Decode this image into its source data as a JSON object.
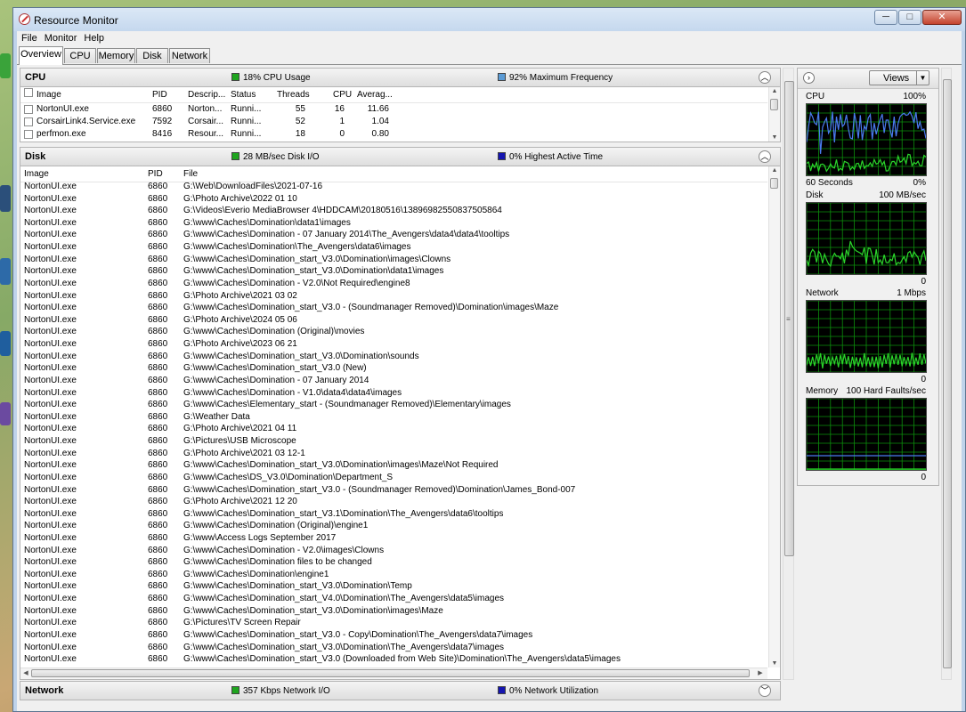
{
  "window": {
    "title": "Resource Monitor",
    "min": "─",
    "max": "□",
    "close": "✕"
  },
  "menu": [
    "File",
    "Monitor",
    "Help"
  ],
  "tabs": [
    "Overview",
    "CPU",
    "Memory",
    "Disk",
    "Network"
  ],
  "cpu": {
    "title": "CPU",
    "usage": "18% CPU Usage",
    "freq": "92% Maximum Frequency",
    "usage_color": "#1fa51f",
    "freq_color": "#5b9bd5",
    "columns": [
      "Image",
      "PID",
      "Descrip...",
      "Status",
      "Threads",
      "CPU",
      "Averag..."
    ],
    "rows": [
      {
        "image": "NortonUI.exe",
        "pid": "6860",
        "desc": "Norton...",
        "status": "Runni...",
        "threads": "55",
        "cpu": "16",
        "avg": "11.66"
      },
      {
        "image": "CorsairLink4.Service.exe",
        "pid": "7592",
        "desc": "Corsair...",
        "status": "Runni...",
        "threads": "52",
        "cpu": "1",
        "avg": "1.04"
      },
      {
        "image": "perfmon.exe",
        "pid": "8416",
        "desc": "Resour...",
        "status": "Runni...",
        "threads": "18",
        "cpu": "0",
        "avg": "0.80"
      }
    ]
  },
  "disk": {
    "title": "Disk",
    "io": "28 MB/sec Disk I/O",
    "active": "0% Highest Active Time",
    "io_color": "#1fa51f",
    "active_color": "#1515b0",
    "columns": [
      "Image",
      "PID",
      "File"
    ],
    "rows": [
      {
        "image": "NortonUI.exe",
        "pid": "6860",
        "file": "G:\\Web\\DownloadFiles\\2021-07-16"
      },
      {
        "image": "NortonUI.exe",
        "pid": "6860",
        "file": "G:\\Photo Archive\\2022 01 10"
      },
      {
        "image": "NortonUI.exe",
        "pid": "6860",
        "file": "G:\\Videos\\Everio MediaBrowser 4\\HDDCAM\\20180516\\13896982550837505864"
      },
      {
        "image": "NortonUI.exe",
        "pid": "6860",
        "file": "G:\\www\\Caches\\Domination\\data1\\images"
      },
      {
        "image": "NortonUI.exe",
        "pid": "6860",
        "file": "G:\\www\\Caches\\Domination - 07 January 2014\\The_Avengers\\data4\\data4\\tooltips"
      },
      {
        "image": "NortonUI.exe",
        "pid": "6860",
        "file": "G:\\www\\Caches\\Domination\\The_Avengers\\data6\\images"
      },
      {
        "image": "NortonUI.exe",
        "pid": "6860",
        "file": "G:\\www\\Caches\\Domination_start_V3.0\\Domination\\images\\Clowns"
      },
      {
        "image": "NortonUI.exe",
        "pid": "6860",
        "file": "G:\\www\\Caches\\Domination_start_V3.0\\Domination\\data1\\images"
      },
      {
        "image": "NortonUI.exe",
        "pid": "6860",
        "file": "G:\\www\\Caches\\Domination - V2.0\\Not Required\\engine8"
      },
      {
        "image": "NortonUI.exe",
        "pid": "6860",
        "file": "G:\\Photo Archive\\2021 03 02"
      },
      {
        "image": "NortonUI.exe",
        "pid": "6860",
        "file": "G:\\www\\Caches\\Domination_start_V3.0 - (Soundmanager Removed)\\Domination\\images\\Maze"
      },
      {
        "image": "NortonUI.exe",
        "pid": "6860",
        "file": "G:\\Photo Archive\\2024 05 06"
      },
      {
        "image": "NortonUI.exe",
        "pid": "6860",
        "file": "G:\\www\\Caches\\Domination (Original)\\movies"
      },
      {
        "image": "NortonUI.exe",
        "pid": "6860",
        "file": "G:\\Photo Archive\\2023 06 21"
      },
      {
        "image": "NortonUI.exe",
        "pid": "6860",
        "file": "G:\\www\\Caches\\Domination_start_V3.0\\Domination\\sounds"
      },
      {
        "image": "NortonUI.exe",
        "pid": "6860",
        "file": "G:\\www\\Caches\\Domination_start_V3.0 (New)"
      },
      {
        "image": "NortonUI.exe",
        "pid": "6860",
        "file": "G:\\www\\Caches\\Domination - 07 January 2014"
      },
      {
        "image": "NortonUI.exe",
        "pid": "6860",
        "file": "G:\\www\\Caches\\Domination - V1.0\\data4\\data4\\images"
      },
      {
        "image": "NortonUI.exe",
        "pid": "6860",
        "file": "G:\\www\\Caches\\Elementary_start - (Soundmanager Removed)\\Elementary\\images"
      },
      {
        "image": "NortonUI.exe",
        "pid": "6860",
        "file": "G:\\Weather Data"
      },
      {
        "image": "NortonUI.exe",
        "pid": "6860",
        "file": "G:\\Photo Archive\\2021 04 11"
      },
      {
        "image": "NortonUI.exe",
        "pid": "6860",
        "file": "G:\\Pictures\\USB Microscope"
      },
      {
        "image": "NortonUI.exe",
        "pid": "6860",
        "file": "G:\\Photo Archive\\2021 03 12-1"
      },
      {
        "image": "NortonUI.exe",
        "pid": "6860",
        "file": "G:\\www\\Caches\\Domination_start_V3.0\\Domination\\images\\Maze\\Not Required"
      },
      {
        "image": "NortonUI.exe",
        "pid": "6860",
        "file": "G:\\www\\Caches\\DS_V3.0\\Domination\\Department_S"
      },
      {
        "image": "NortonUI.exe",
        "pid": "6860",
        "file": "G:\\www\\Caches\\Domination_start_V3.0 - (Soundmanager Removed)\\Domination\\James_Bond-007"
      },
      {
        "image": "NortonUI.exe",
        "pid": "6860",
        "file": "G:\\Photo Archive\\2021 12 20"
      },
      {
        "image": "NortonUI.exe",
        "pid": "6860",
        "file": "G:\\www\\Caches\\Domination_start_V3.1\\Domination\\The_Avengers\\data6\\tooltips"
      },
      {
        "image": "NortonUI.exe",
        "pid": "6860",
        "file": "G:\\www\\Caches\\Domination (Original)\\engine1"
      },
      {
        "image": "NortonUI.exe",
        "pid": "6860",
        "file": "G:\\www\\Access Logs September 2017"
      },
      {
        "image": "NortonUI.exe",
        "pid": "6860",
        "file": "G:\\www\\Caches\\Domination - V2.0\\images\\Clowns"
      },
      {
        "image": "NortonUI.exe",
        "pid": "6860",
        "file": "G:\\www\\Caches\\Domination files to be changed"
      },
      {
        "image": "NortonUI.exe",
        "pid": "6860",
        "file": "G:\\www\\Caches\\Domination\\engine1"
      },
      {
        "image": "NortonUI.exe",
        "pid": "6860",
        "file": "G:\\www\\Caches\\Domination_start_V3.0\\Domination\\Temp"
      },
      {
        "image": "NortonUI.exe",
        "pid": "6860",
        "file": "G:\\www\\Caches\\Domination_start_V4.0\\Domination\\The_Avengers\\data5\\images"
      },
      {
        "image": "NortonUI.exe",
        "pid": "6860",
        "file": "G:\\www\\Caches\\Domination_start_V3.0\\Domination\\images\\Maze"
      },
      {
        "image": "NortonUI.exe",
        "pid": "6860",
        "file": "G:\\Pictures\\TV Screen Repair"
      },
      {
        "image": "NortonUI.exe",
        "pid": "6860",
        "file": "G:\\www\\Caches\\Domination_start_V3.0 - Copy\\Domination\\The_Avengers\\data7\\images"
      },
      {
        "image": "NortonUI.exe",
        "pid": "6860",
        "file": "G:\\www\\Caches\\Domination_start_V3.0\\Domination\\The_Avengers\\data7\\images"
      },
      {
        "image": "NortonUI.exe",
        "pid": "6860",
        "file": "G:\\www\\Caches\\Domination_start_V3.0 (Downloaded from Web Site)\\Domination\\The_Avengers\\data5\\images"
      }
    ]
  },
  "network": {
    "title": "Network",
    "io": "357 Kbps Network I/O",
    "util": "0% Network Utilization",
    "io_color": "#1fa51f",
    "util_color": "#1515b0"
  },
  "right_panel": {
    "views_label": "Views",
    "graphs": [
      {
        "name": "CPU",
        "max": "100%",
        "foot_left": "60 Seconds",
        "foot_right": "0%"
      },
      {
        "name": "Disk",
        "max": "100 MB/sec",
        "foot_left": "",
        "foot_right": "0"
      },
      {
        "name": "Network",
        "max": "1 Mbps",
        "foot_left": "",
        "foot_right": "0"
      },
      {
        "name": "Memory",
        "max": "100 Hard Faults/sec",
        "foot_left": "",
        "foot_right": "0"
      }
    ],
    "grid_color": "#0c8f0c",
    "line_green": "#2bd62b",
    "line_blue": "#4a7bf0"
  }
}
